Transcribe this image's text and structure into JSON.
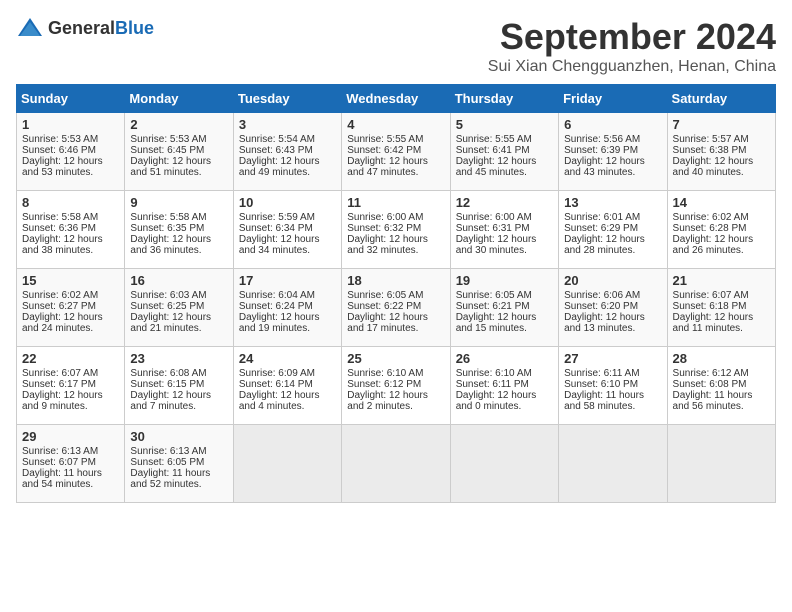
{
  "header": {
    "logo_general": "General",
    "logo_blue": "Blue",
    "month_year": "September 2024",
    "location": "Sui Xian Chengguanzhen, Henan, China"
  },
  "weekdays": [
    "Sunday",
    "Monday",
    "Tuesday",
    "Wednesday",
    "Thursday",
    "Friday",
    "Saturday"
  ],
  "weeks": [
    [
      {
        "day": "1",
        "lines": [
          "Sunrise: 5:53 AM",
          "Sunset: 6:46 PM",
          "Daylight: 12 hours",
          "and 53 minutes."
        ]
      },
      {
        "day": "2",
        "lines": [
          "Sunrise: 5:53 AM",
          "Sunset: 6:45 PM",
          "Daylight: 12 hours",
          "and 51 minutes."
        ]
      },
      {
        "day": "3",
        "lines": [
          "Sunrise: 5:54 AM",
          "Sunset: 6:43 PM",
          "Daylight: 12 hours",
          "and 49 minutes."
        ]
      },
      {
        "day": "4",
        "lines": [
          "Sunrise: 5:55 AM",
          "Sunset: 6:42 PM",
          "Daylight: 12 hours",
          "and 47 minutes."
        ]
      },
      {
        "day": "5",
        "lines": [
          "Sunrise: 5:55 AM",
          "Sunset: 6:41 PM",
          "Daylight: 12 hours",
          "and 45 minutes."
        ]
      },
      {
        "day": "6",
        "lines": [
          "Sunrise: 5:56 AM",
          "Sunset: 6:39 PM",
          "Daylight: 12 hours",
          "and 43 minutes."
        ]
      },
      {
        "day": "7",
        "lines": [
          "Sunrise: 5:57 AM",
          "Sunset: 6:38 PM",
          "Daylight: 12 hours",
          "and 40 minutes."
        ]
      }
    ],
    [
      {
        "day": "8",
        "lines": [
          "Sunrise: 5:58 AM",
          "Sunset: 6:36 PM",
          "Daylight: 12 hours",
          "and 38 minutes."
        ]
      },
      {
        "day": "9",
        "lines": [
          "Sunrise: 5:58 AM",
          "Sunset: 6:35 PM",
          "Daylight: 12 hours",
          "and 36 minutes."
        ]
      },
      {
        "day": "10",
        "lines": [
          "Sunrise: 5:59 AM",
          "Sunset: 6:34 PM",
          "Daylight: 12 hours",
          "and 34 minutes."
        ]
      },
      {
        "day": "11",
        "lines": [
          "Sunrise: 6:00 AM",
          "Sunset: 6:32 PM",
          "Daylight: 12 hours",
          "and 32 minutes."
        ]
      },
      {
        "day": "12",
        "lines": [
          "Sunrise: 6:00 AM",
          "Sunset: 6:31 PM",
          "Daylight: 12 hours",
          "and 30 minutes."
        ]
      },
      {
        "day": "13",
        "lines": [
          "Sunrise: 6:01 AM",
          "Sunset: 6:29 PM",
          "Daylight: 12 hours",
          "and 28 minutes."
        ]
      },
      {
        "day": "14",
        "lines": [
          "Sunrise: 6:02 AM",
          "Sunset: 6:28 PM",
          "Daylight: 12 hours",
          "and 26 minutes."
        ]
      }
    ],
    [
      {
        "day": "15",
        "lines": [
          "Sunrise: 6:02 AM",
          "Sunset: 6:27 PM",
          "Daylight: 12 hours",
          "and 24 minutes."
        ]
      },
      {
        "day": "16",
        "lines": [
          "Sunrise: 6:03 AM",
          "Sunset: 6:25 PM",
          "Daylight: 12 hours",
          "and 21 minutes."
        ]
      },
      {
        "day": "17",
        "lines": [
          "Sunrise: 6:04 AM",
          "Sunset: 6:24 PM",
          "Daylight: 12 hours",
          "and 19 minutes."
        ]
      },
      {
        "day": "18",
        "lines": [
          "Sunrise: 6:05 AM",
          "Sunset: 6:22 PM",
          "Daylight: 12 hours",
          "and 17 minutes."
        ]
      },
      {
        "day": "19",
        "lines": [
          "Sunrise: 6:05 AM",
          "Sunset: 6:21 PM",
          "Daylight: 12 hours",
          "and 15 minutes."
        ]
      },
      {
        "day": "20",
        "lines": [
          "Sunrise: 6:06 AM",
          "Sunset: 6:20 PM",
          "Daylight: 12 hours",
          "and 13 minutes."
        ]
      },
      {
        "day": "21",
        "lines": [
          "Sunrise: 6:07 AM",
          "Sunset: 6:18 PM",
          "Daylight: 12 hours",
          "and 11 minutes."
        ]
      }
    ],
    [
      {
        "day": "22",
        "lines": [
          "Sunrise: 6:07 AM",
          "Sunset: 6:17 PM",
          "Daylight: 12 hours",
          "and 9 minutes."
        ]
      },
      {
        "day": "23",
        "lines": [
          "Sunrise: 6:08 AM",
          "Sunset: 6:15 PM",
          "Daylight: 12 hours",
          "and 7 minutes."
        ]
      },
      {
        "day": "24",
        "lines": [
          "Sunrise: 6:09 AM",
          "Sunset: 6:14 PM",
          "Daylight: 12 hours",
          "and 4 minutes."
        ]
      },
      {
        "day": "25",
        "lines": [
          "Sunrise: 6:10 AM",
          "Sunset: 6:12 PM",
          "Daylight: 12 hours",
          "and 2 minutes."
        ]
      },
      {
        "day": "26",
        "lines": [
          "Sunrise: 6:10 AM",
          "Sunset: 6:11 PM",
          "Daylight: 12 hours",
          "and 0 minutes."
        ]
      },
      {
        "day": "27",
        "lines": [
          "Sunrise: 6:11 AM",
          "Sunset: 6:10 PM",
          "Daylight: 11 hours",
          "and 58 minutes."
        ]
      },
      {
        "day": "28",
        "lines": [
          "Sunrise: 6:12 AM",
          "Sunset: 6:08 PM",
          "Daylight: 11 hours",
          "and 56 minutes."
        ]
      }
    ],
    [
      {
        "day": "29",
        "lines": [
          "Sunrise: 6:13 AM",
          "Sunset: 6:07 PM",
          "Daylight: 11 hours",
          "and 54 minutes."
        ]
      },
      {
        "day": "30",
        "lines": [
          "Sunrise: 6:13 AM",
          "Sunset: 6:05 PM",
          "Daylight: 11 hours",
          "and 52 minutes."
        ]
      },
      {
        "day": "",
        "lines": []
      },
      {
        "day": "",
        "lines": []
      },
      {
        "day": "",
        "lines": []
      },
      {
        "day": "",
        "lines": []
      },
      {
        "day": "",
        "lines": []
      }
    ]
  ]
}
